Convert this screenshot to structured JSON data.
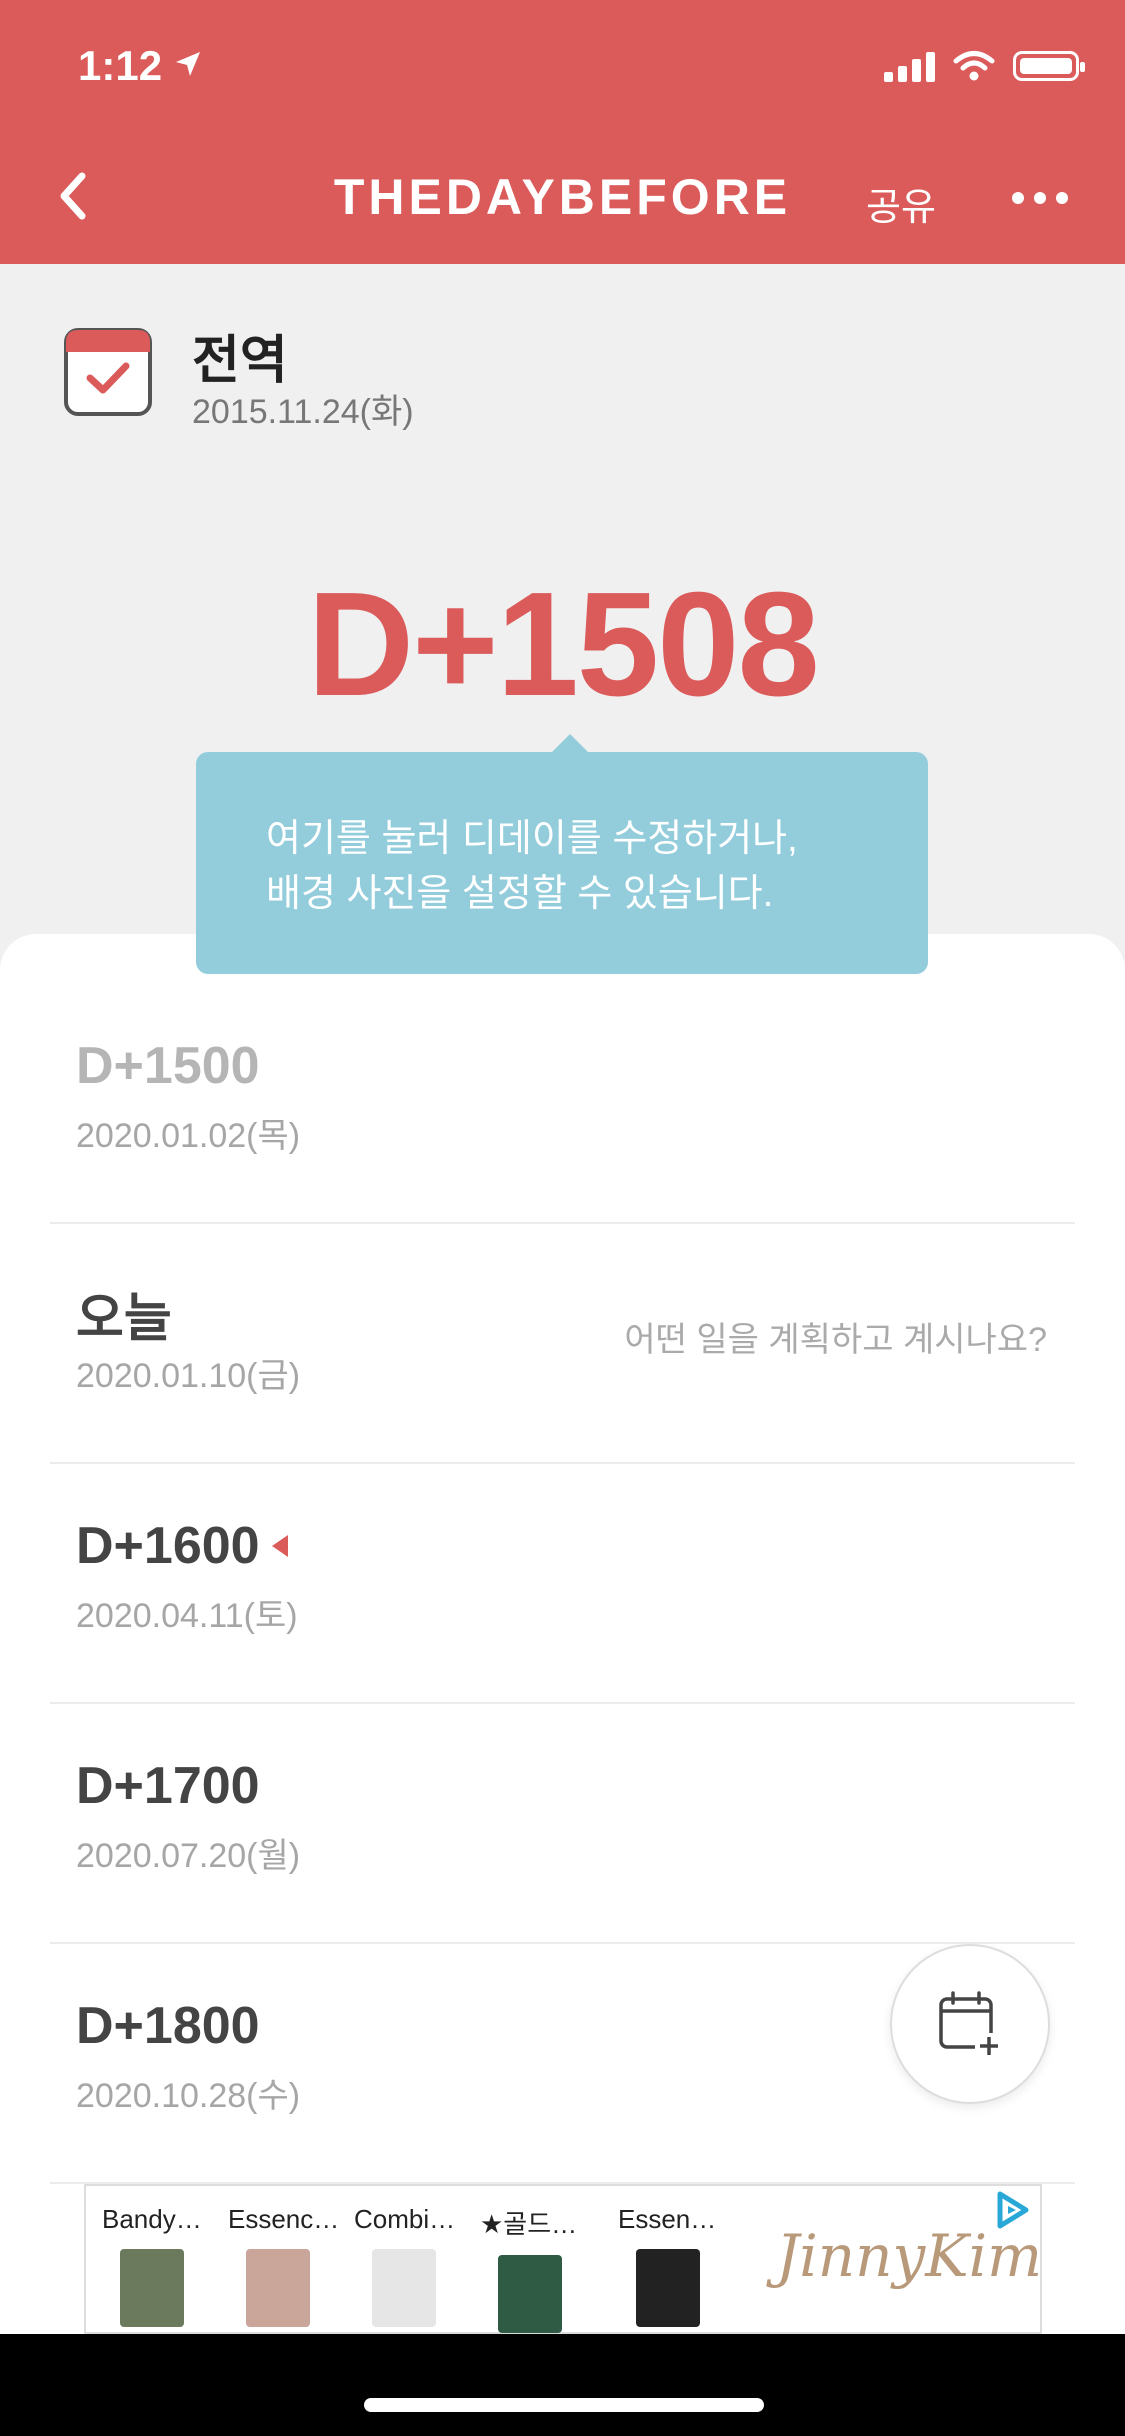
{
  "status": {
    "time": "1:12"
  },
  "header": {
    "brand": "THEDAYBEFORE",
    "share": "공유"
  },
  "event": {
    "title": "전역",
    "date": "2015.11.24(화)",
    "count": "D+1508"
  },
  "tooltip": {
    "line1": "여기를 눌러 디데이를 수정하거나,",
    "line2": "배경 사진을 설정할 수 있습니다."
  },
  "rows": [
    {
      "count": "D+1500",
      "date": "2020.01.02(목)"
    },
    {
      "count": "오늘",
      "date": "2020.01.10(금)",
      "hint": "어떤 일을 계획하고 계시나요?"
    },
    {
      "count": "D+1600",
      "date": "2020.04.11(토)"
    },
    {
      "count": "D+1700",
      "date": "2020.07.20(월)"
    },
    {
      "count": "D+1800",
      "date": "2020.10.28(수)"
    }
  ],
  "ad": {
    "items": [
      "Bandy…",
      "Essenc…",
      "Combi…",
      "★골드…",
      "Essen…"
    ],
    "brand": "JinnyKim"
  },
  "colors": {
    "accent": "#db5b5b",
    "tooltip": "#93cddc"
  }
}
